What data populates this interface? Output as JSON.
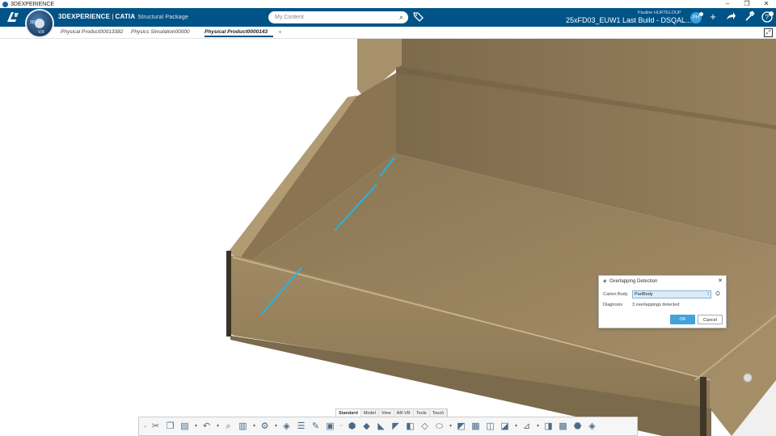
{
  "window": {
    "title": "3DEXPERIENCE",
    "minimize": "–",
    "restore": "❐",
    "close": "✕"
  },
  "topbar": {
    "brand_strong": "3DEXPERIENCE",
    "brand_sep": "|",
    "brand_app": "CATIA",
    "brand_package": "Structural Package",
    "compass_label_3d": "3D",
    "compass_label_v": "V,R",
    "search_placeholder": "My Content",
    "user_name": "Pauline HURTELOUP",
    "context_title": "25xFD03_EUW1 Last Build - DSQAL... ⌄",
    "avatar_initials": "PH"
  },
  "tabs": [
    {
      "label": "Physical Product00013382"
    },
    {
      "label": "Physics Simulation00000"
    },
    {
      "label": "Physical Product0000143"
    }
  ],
  "tab_add": "+",
  "dialog": {
    "title": "Overlapping Detection",
    "close": "✕",
    "carton_label": "Carton Body",
    "carton_value": "PartBody",
    "diagnosis_label": "Diagnosis",
    "diagnosis_value": "3 overlappings detected",
    "ok": "OK",
    "cancel": "Cancel"
  },
  "section_tabs": [
    "Standard",
    "Model",
    "View",
    "AR-VR",
    "Tools",
    "Touch"
  ],
  "colors": {
    "topbar": "#005386",
    "carton_top": "#a18b65",
    "carton_inner": "#8b7654",
    "overlap_highlight": "#1fb6e6",
    "ok_button": "#42a2da"
  },
  "icons": [
    "ds-logo-icon",
    "compass-icon",
    "search-icon",
    "tag-icon",
    "add-icon",
    "share-icon",
    "tools-icon",
    "help-icon",
    "fullscreen-icon"
  ]
}
